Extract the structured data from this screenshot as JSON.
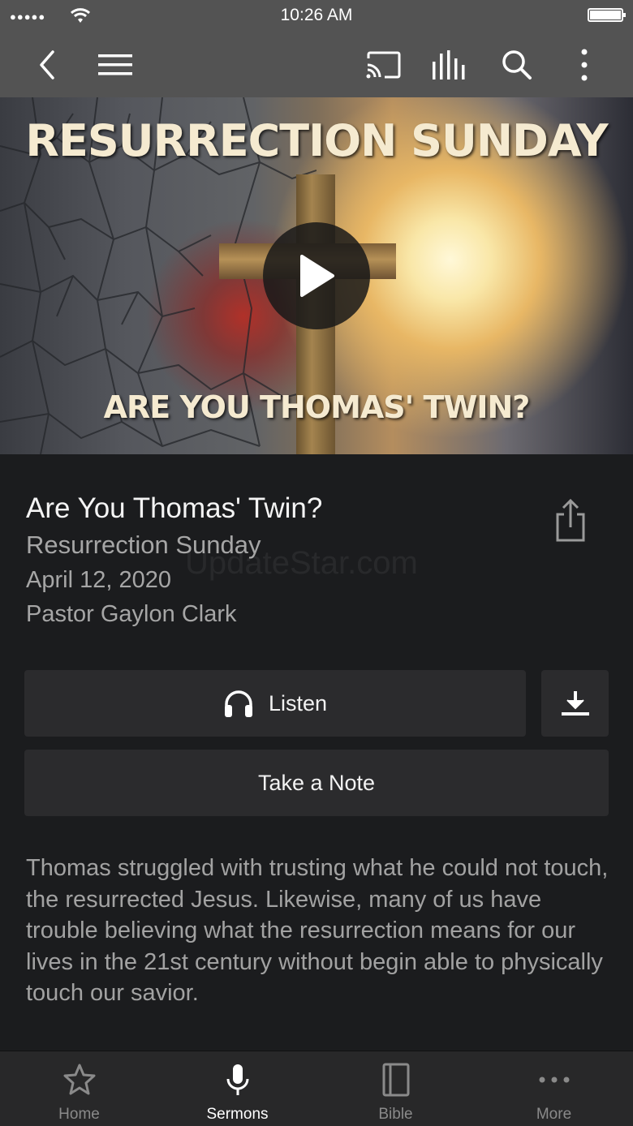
{
  "status_bar": {
    "time": "10:26 AM",
    "signal": "●●●●●"
  },
  "toolbar": {
    "back_icon": "chevron-left-icon",
    "menu_icon": "hamburger-icon",
    "cast_icon": "cast-icon",
    "equalizer_icon": "equalizer-icon",
    "search_icon": "search-icon",
    "more_icon": "more-vertical-icon"
  },
  "hero": {
    "title": "RESURRECTION SUNDAY",
    "subtitle": "ARE YOU THOMAS' TWIN?"
  },
  "sermon": {
    "title": "Are You Thomas' Twin?",
    "series": "Resurrection Sunday",
    "date": "April 12, 2020",
    "speaker": "Pastor Gaylon Clark"
  },
  "watermark": "UpdateStar.com",
  "actions": {
    "listen_label": "Listen",
    "note_label": "Take a Note"
  },
  "description": "Thomas struggled with trusting what he could not touch, the resurrected Jesus. Likewise, many of us have trouble believing what the resurrection means for our lives in the 21st century without begin able to physically touch our savior.",
  "tabs": [
    {
      "label": "Home",
      "icon": "star-icon",
      "active": false
    },
    {
      "label": "Sermons",
      "icon": "microphone-icon",
      "active": true
    },
    {
      "label": "Bible",
      "icon": "book-icon",
      "active": false
    },
    {
      "label": "More",
      "icon": "more-horizontal-icon",
      "active": false
    }
  ],
  "colors": {
    "bar": "#535353",
    "background": "#1b1c1e",
    "button": "#2b2b2d",
    "muted_text": "#a6a6a6"
  }
}
